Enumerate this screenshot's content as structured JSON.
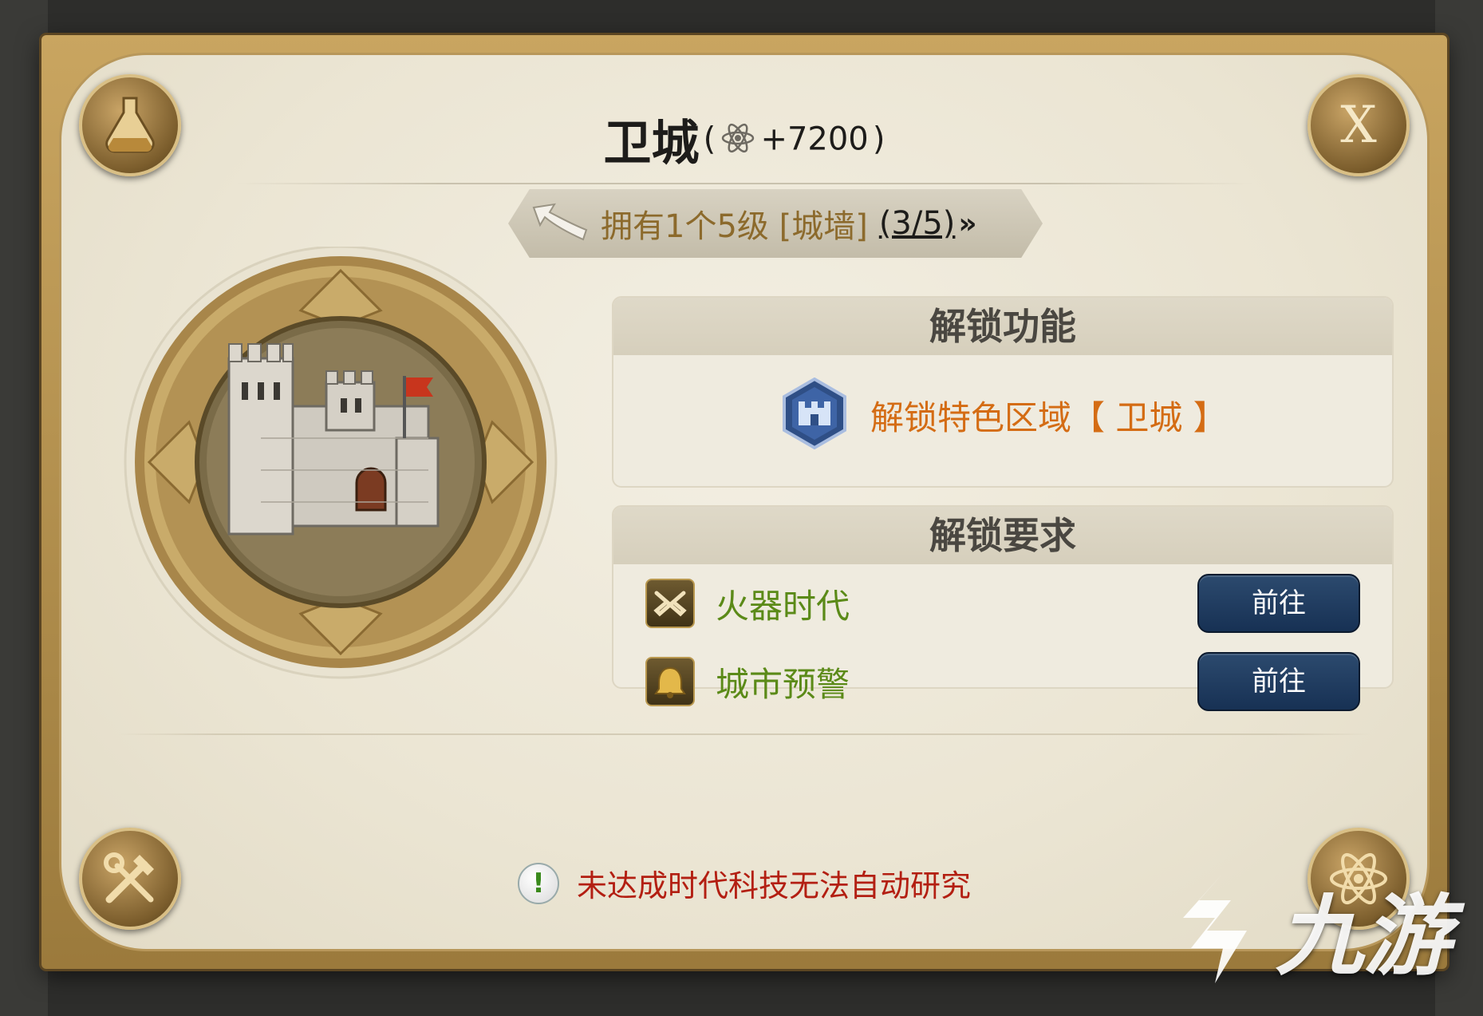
{
  "dialog": {
    "title": "卫城",
    "reward_open": "(",
    "reward_value": "+7200",
    "reward_close": ")",
    "reward_icon": "atom-icon",
    "close_label": "X"
  },
  "quest": {
    "text": "拥有1个5级 [城墙]",
    "progress": "(3/5)",
    "chevrons": "»"
  },
  "unlock_feature": {
    "header": "解锁功能",
    "item_label": "解锁特色区域【 卫城 】",
    "item_icon": "castle-badge-icon"
  },
  "unlock_requirements": {
    "header": "解锁要求",
    "items": [
      {
        "label": "火器时代",
        "icon": "crossed-pistols-icon",
        "button": "前往"
      },
      {
        "label": "城市预警",
        "icon": "bell-icon",
        "button": "前往"
      }
    ]
  },
  "warning": {
    "text": "未达成时代科技无法自动研究",
    "icon": "exclamation-icon"
  },
  "watermark": {
    "text": "九游"
  },
  "colors": {
    "accent_gold": "#b8975a",
    "feature_orange": "#d46c14",
    "requirement_green": "#5b8a18",
    "warning_red": "#b31f12",
    "button_blue": "#1f3a5f"
  }
}
